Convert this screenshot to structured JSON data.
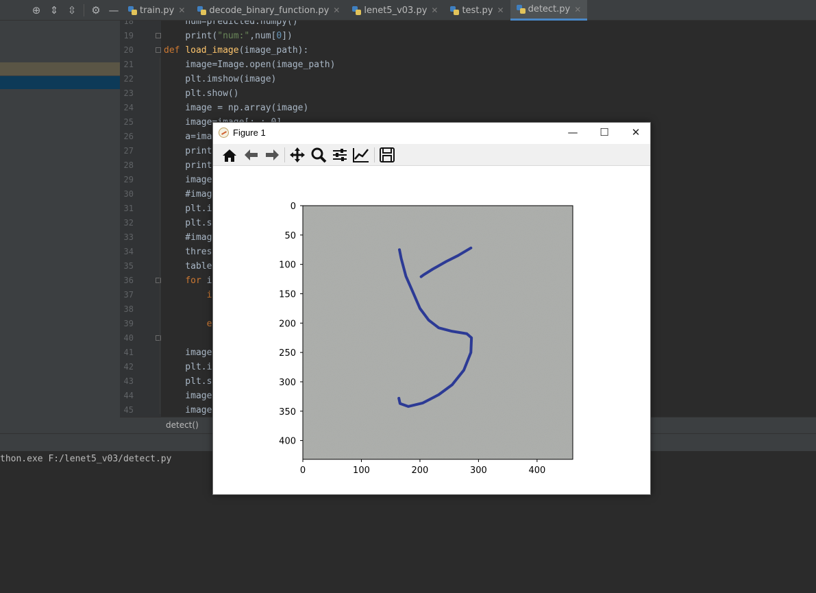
{
  "toolbar_icons": [
    "target-icon",
    "expand-all-icon",
    "collapse-all-icon",
    "gear-icon",
    "minimize-icon"
  ],
  "tabs": [
    {
      "label": "train.py",
      "active": false
    },
    {
      "label": "decode_binary_function.py",
      "active": false
    },
    {
      "label": "lenet5_v03.py",
      "active": false
    },
    {
      "label": "test.py",
      "active": false
    },
    {
      "label": "detect.py",
      "active": true
    }
  ],
  "editor": {
    "lines": [
      {
        "n": "18",
        "html": "    <span>num=predicted.numpy()</span>"
      },
      {
        "n": "19",
        "html": "    <span class=\"kw\"></span>print(<span class=\"str\">\"num:\"</span>,num[<span class=\"num\">0</span>])"
      },
      {
        "n": "20",
        "html": "<span class=\"kw\">def </span><span class=\"fn\">load_image</span>(image_path):"
      },
      {
        "n": "21",
        "html": "    image=Image.open(image_path)"
      },
      {
        "n": "22",
        "html": "    plt.imshow(image)"
      },
      {
        "n": "23",
        "html": "    plt.show()"
      },
      {
        "n": "24",
        "html": "    image = np.array(image)"
      },
      {
        "n": "25",
        "html": "    image=image[:,:,0]"
      },
      {
        "n": "26",
        "html": "    a=ima"
      },
      {
        "n": "27",
        "html": "    print"
      },
      {
        "n": "28",
        "html": "    print"
      },
      {
        "n": "29",
        "html": "    image"
      },
      {
        "n": "30",
        "html": "    #imag"
      },
      {
        "n": "31",
        "html": "    plt.i"
      },
      {
        "n": "32",
        "html": "    plt.s"
      },
      {
        "n": "33",
        "html": "    #imag"
      },
      {
        "n": "34",
        "html": "    thres"
      },
      {
        "n": "35",
        "html": "    table"
      },
      {
        "n": "36",
        "html": "    <span class=\"kw\">for</span> i"
      },
      {
        "n": "37",
        "html": "        <span class=\"kw\">i</span>"
      },
      {
        "n": "38",
        "html": ""
      },
      {
        "n": "39",
        "html": "        <span class=\"kw\">e</span>"
      },
      {
        "n": "40",
        "html": ""
      },
      {
        "n": "41",
        "html": "    image"
      },
      {
        "n": "42",
        "html": "    plt.i"
      },
      {
        "n": "43",
        "html": "    plt.s"
      },
      {
        "n": "44",
        "html": "    image"
      },
      {
        "n": "45",
        "html": "    image"
      }
    ],
    "breadcrumb": "detect()"
  },
  "console": {
    "output": "thon.exe F:/lenet5_v03/detect.py"
  },
  "figure": {
    "title": "Figure 1",
    "tool_icons": [
      "home-icon",
      "back-arrow-icon",
      "forward-arrow-icon",
      "pan-icon",
      "zoom-icon",
      "subplots-config-icon",
      "edit-axes-icon",
      "save-icon"
    ],
    "window_buttons": {
      "minimize": "—",
      "maximize": "☐",
      "close": "✕"
    }
  },
  "chart_data": {
    "type": "image",
    "title": "",
    "xlabel": "",
    "ylabel": "",
    "x_ticks": [
      "0",
      "100",
      "200",
      "300",
      "400"
    ],
    "y_ticks": [
      "0",
      "50",
      "100",
      "150",
      "200",
      "250",
      "300",
      "350",
      "400"
    ],
    "xlim": [
      0,
      461
    ],
    "ylim": [
      432,
      0
    ],
    "image_content": "handwritten digit 5 in blue ink on gray paper",
    "colors": {
      "paper": "#a9aba8",
      "ink": "#2c3a95"
    }
  }
}
